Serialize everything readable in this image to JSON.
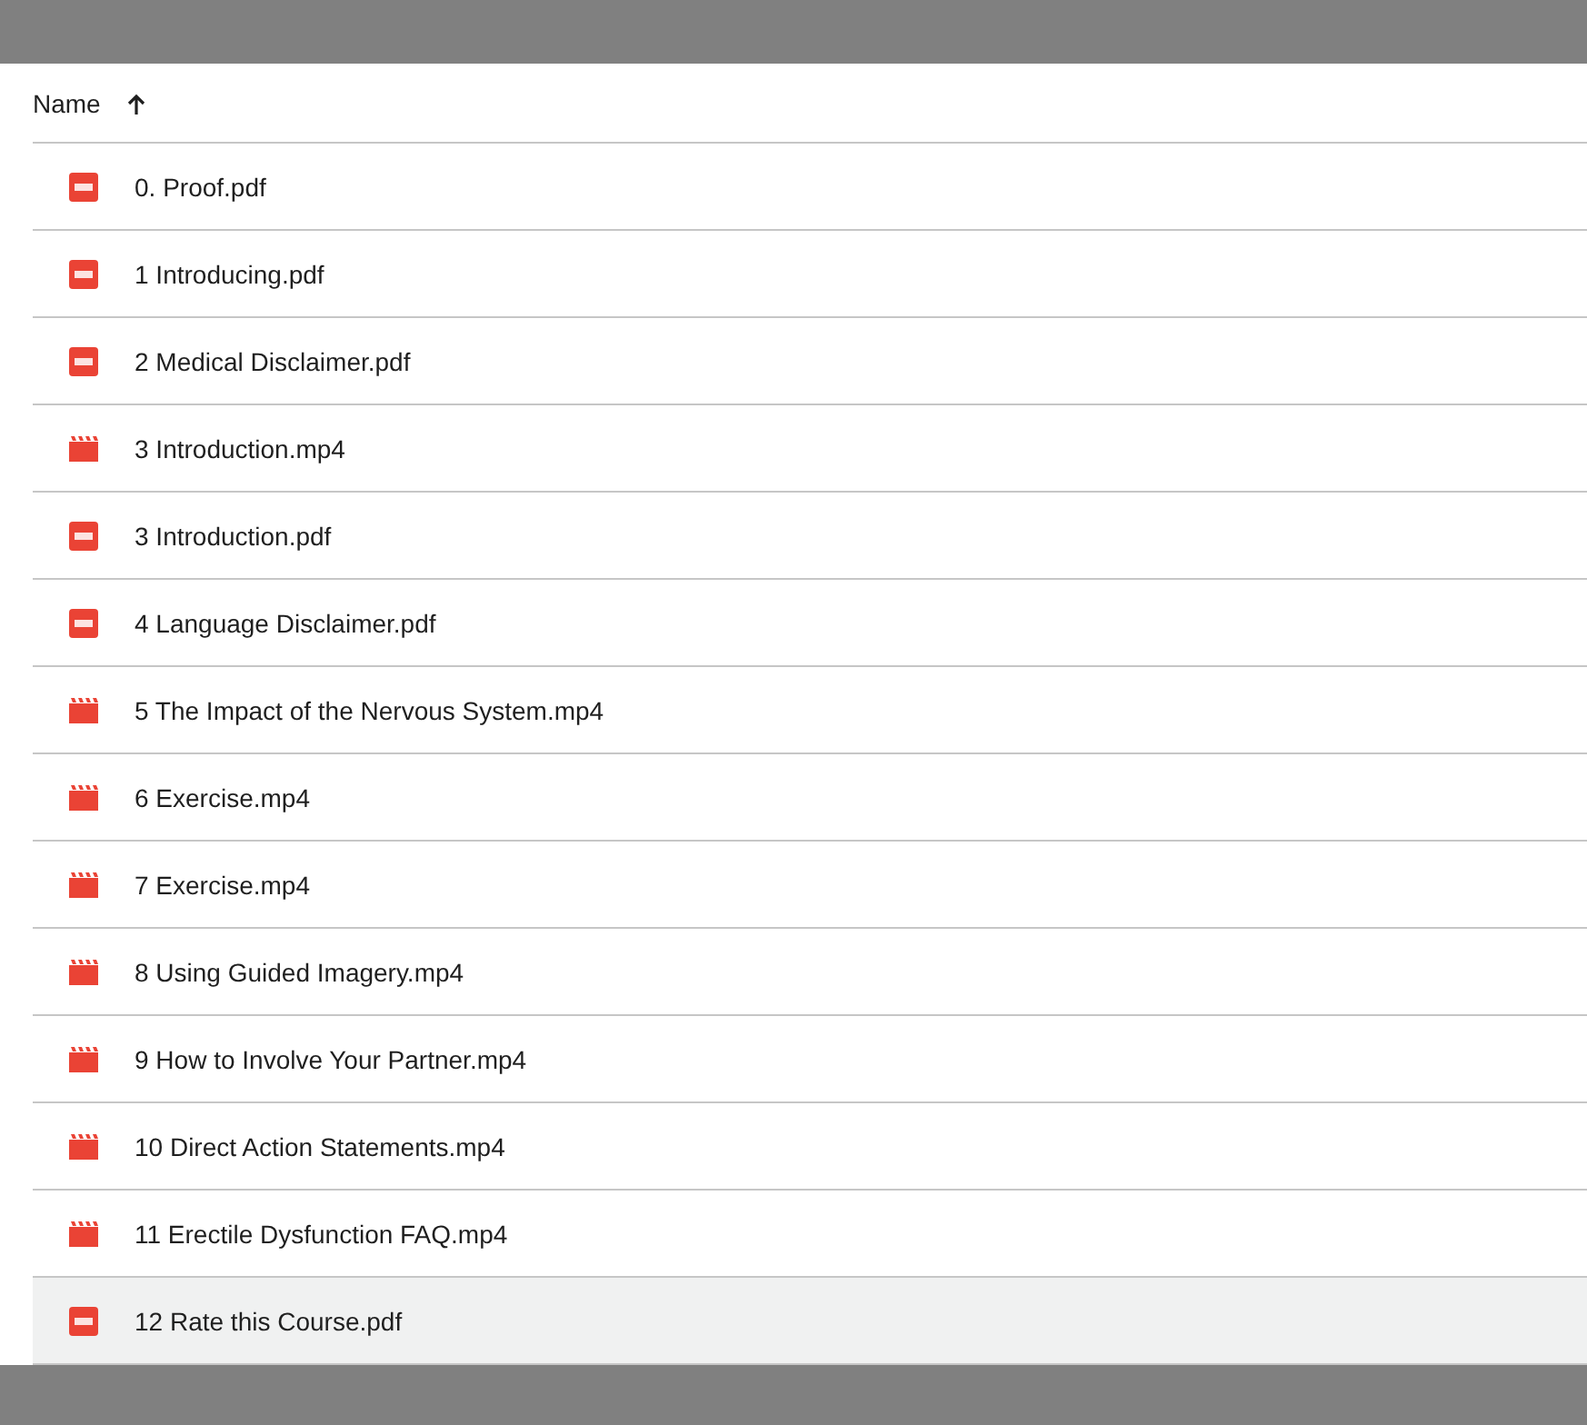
{
  "table": {
    "columns": [
      {
        "label": "Name",
        "sorted_ascending": true
      }
    ],
    "rows": [
      {
        "name": "0. Proof.pdf",
        "kind": "pdf",
        "selected": false
      },
      {
        "name": "1 Introducing.pdf",
        "kind": "pdf",
        "selected": false
      },
      {
        "name": "2 Medical Disclaimer.pdf",
        "kind": "pdf",
        "selected": false
      },
      {
        "name": "3 Introduction.mp4",
        "kind": "video",
        "selected": false
      },
      {
        "name": "3 Introduction.pdf",
        "kind": "pdf",
        "selected": false
      },
      {
        "name": "4 Language Disclaimer.pdf",
        "kind": "pdf",
        "selected": false
      },
      {
        "name": "5 The Impact of the Nervous System.mp4",
        "kind": "video",
        "selected": false
      },
      {
        "name": "6 Exercise.mp4",
        "kind": "video",
        "selected": false
      },
      {
        "name": "7 Exercise.mp4",
        "kind": "video",
        "selected": false
      },
      {
        "name": "8 Using Guided Imagery.mp4",
        "kind": "video",
        "selected": false
      },
      {
        "name": "9 How to Involve Your Partner.mp4",
        "kind": "video",
        "selected": false
      },
      {
        "name": "10 Direct Action Statements.mp4",
        "kind": "video",
        "selected": false
      },
      {
        "name": "11 Erectile Dysfunction FAQ.mp4",
        "kind": "video",
        "selected": false
      },
      {
        "name": "12 Rate this Course.pdf",
        "kind": "pdf",
        "selected": true
      }
    ]
  }
}
